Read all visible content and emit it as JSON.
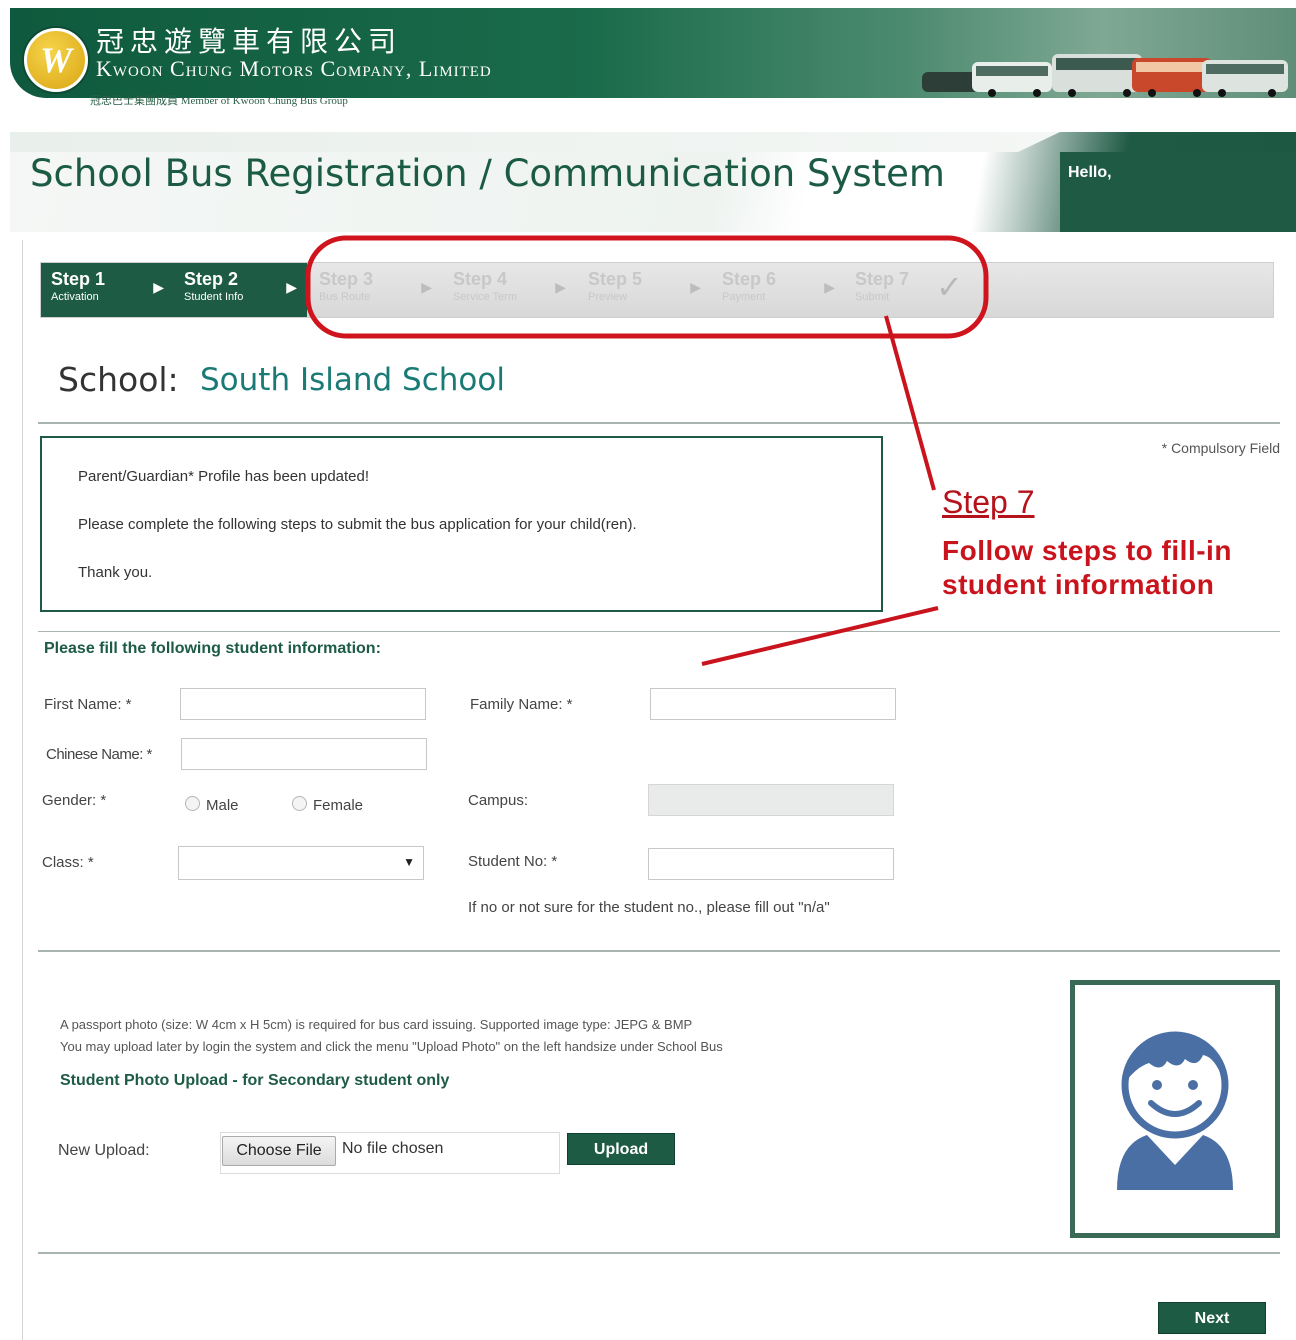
{
  "header": {
    "company_cn": "冠忠遊覽車有限公司",
    "company_en": "Kwoon Chung Motors Company, Limited",
    "member_line": "冠忠巴士集團成員  Member of Kwoon Chung Bus Group",
    "logo_letter": "W"
  },
  "title_bar": {
    "title": "School Bus Registration / Communication System",
    "greeting": "Hello,"
  },
  "steps": [
    {
      "title": "Step 1",
      "sub": "Activation",
      "state": "active"
    },
    {
      "title": "Step 2",
      "sub": "Student Info",
      "state": "active"
    },
    {
      "title": "Step 3",
      "sub": "Bus Route",
      "state": "inactive"
    },
    {
      "title": "Step 4",
      "sub": "Service Term",
      "state": "inactive"
    },
    {
      "title": "Step 5",
      "sub": "Preview",
      "state": "inactive"
    },
    {
      "title": "Step 6",
      "sub": "Payment",
      "state": "inactive"
    },
    {
      "title": "Step 7",
      "sub": "Submit",
      "state": "inactive"
    }
  ],
  "annotation": {
    "title": "Step 7",
    "text": "Follow steps to fill-in student information",
    "color": "#c9141d"
  },
  "school": {
    "label": "School:",
    "name": "South Island School"
  },
  "compulsory_note": "* Compulsory Field",
  "message": {
    "line1": "Parent/Guardian* Profile has been updated!",
    "line2": "Please complete the following steps to submit the bus application for your child(ren).",
    "line3": "Thank you."
  },
  "form": {
    "heading": "Please fill the following student information:",
    "first_name_label": "First Name: *",
    "first_name_value": "",
    "family_name_label": "Family Name: *",
    "family_name_value": "",
    "chinese_name_label": "Chinese Name: *",
    "chinese_name_value": "",
    "gender_label": "Gender: *",
    "gender_options": [
      "Male",
      "Female"
    ],
    "campus_label": "Campus:",
    "campus_value": "",
    "class_label": "Class: *",
    "class_value": "",
    "student_no_label": "Student No: *",
    "student_no_value": "",
    "student_no_hint": "If no or not sure for the student no., please fill out \"n/a\""
  },
  "upload": {
    "note_line1": "A passport photo (size: W 4cm x H 5cm) is required for bus card issuing. Supported image type: JEPG & BMP",
    "note_line2": "You may upload later by login the system and click the menu \"Upload Photo\" on the left handsize under School Bus",
    "title": "Student Photo Upload - for Secondary student only",
    "new_upload_label": "New Upload:",
    "choose_file_label": "Choose File",
    "no_file_text": "No file chosen",
    "upload_button": "Upload"
  },
  "next_button": "Next",
  "colors": {
    "brand_green": "#1d5b44",
    "school_name": "#1a7a76",
    "avatar_blue": "#4a6fa5",
    "annotation_red": "#c9141d"
  }
}
